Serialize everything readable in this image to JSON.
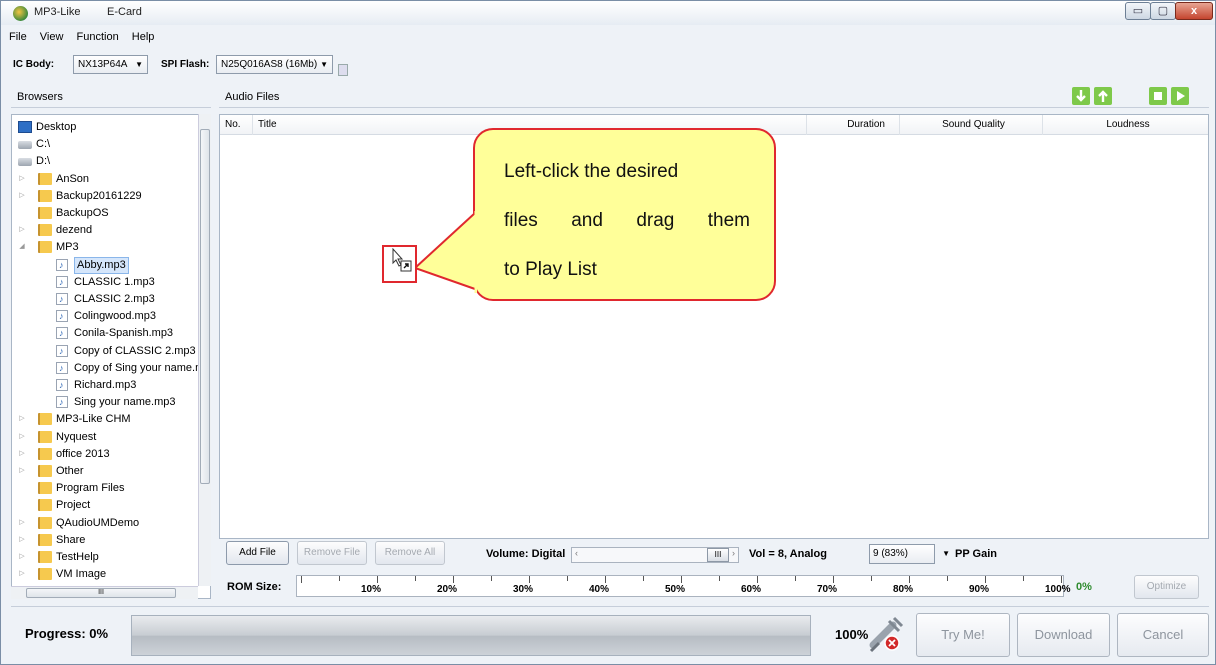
{
  "window": {
    "title": "MP3-Like",
    "subtitle": "E-Card",
    "controls": {
      "minimize": "▭",
      "maximize": "▢",
      "close": "x"
    }
  },
  "menu": {
    "items": [
      "File",
      "View",
      "Function",
      "Help"
    ]
  },
  "toolbar": {
    "ic_body_label": "IC Body:",
    "ic_body_value": "NX13P64A",
    "spi_flash_label": "SPI Flash:",
    "spi_flash_value": "N25Q016AS8 (16Mb)"
  },
  "browsers": {
    "header": "Browsers",
    "items": [
      {
        "label": "Desktop",
        "type": "desktop",
        "level": 0,
        "expander": ""
      },
      {
        "label": "C:\\",
        "type": "drive",
        "level": 0,
        "expander": ""
      },
      {
        "label": "D:\\",
        "type": "drive",
        "level": 0,
        "expander": ""
      },
      {
        "label": "AnSon",
        "type": "folder",
        "level": 1,
        "expander": "▷"
      },
      {
        "label": "Backup20161229",
        "type": "folder",
        "level": 1,
        "expander": "▷"
      },
      {
        "label": "BackupOS",
        "type": "folder",
        "level": 1,
        "expander": ""
      },
      {
        "label": "dezend",
        "type": "folder",
        "level": 1,
        "expander": "▷"
      },
      {
        "label": "MP3",
        "type": "folder",
        "level": 1,
        "expander": "◢"
      },
      {
        "label": "Abby.mp3",
        "type": "file",
        "level": 2,
        "expander": "",
        "selected": true
      },
      {
        "label": "CLASSIC 1.mp3",
        "type": "file",
        "level": 2,
        "expander": ""
      },
      {
        "label": "CLASSIC 2.mp3",
        "type": "file",
        "level": 2,
        "expander": ""
      },
      {
        "label": "Colingwood.mp3",
        "type": "file",
        "level": 2,
        "expander": ""
      },
      {
        "label": "Conila-Spanish.mp3",
        "type": "file",
        "level": 2,
        "expander": ""
      },
      {
        "label": "Copy of CLASSIC 2.mp3",
        "type": "file",
        "level": 2,
        "expander": ""
      },
      {
        "label": "Copy of Sing your name.mp",
        "type": "file",
        "level": 2,
        "expander": ""
      },
      {
        "label": "Richard.mp3",
        "type": "file",
        "level": 2,
        "expander": ""
      },
      {
        "label": "Sing your name.mp3",
        "type": "file",
        "level": 2,
        "expander": ""
      },
      {
        "label": "MP3-Like CHM",
        "type": "folder",
        "level": 1,
        "expander": "▷"
      },
      {
        "label": "Nyquest",
        "type": "folder",
        "level": 1,
        "expander": "▷"
      },
      {
        "label": "office 2013",
        "type": "folder",
        "level": 1,
        "expander": "▷"
      },
      {
        "label": "Other",
        "type": "folder",
        "level": 1,
        "expander": "▷"
      },
      {
        "label": "Program Files",
        "type": "folder",
        "level": 1,
        "expander": ""
      },
      {
        "label": "Project",
        "type": "folder",
        "level": 1,
        "expander": ""
      },
      {
        "label": "QAudioUMDemo",
        "type": "folder",
        "level": 1,
        "expander": "▷"
      },
      {
        "label": "Share",
        "type": "folder",
        "level": 1,
        "expander": "▷"
      },
      {
        "label": "TestHelp",
        "type": "folder",
        "level": 1,
        "expander": "▷"
      },
      {
        "label": "VM Image",
        "type": "folder",
        "level": 1,
        "expander": "▷"
      }
    ],
    "hscroll_glyph": "III"
  },
  "audio": {
    "header": "Audio Files",
    "columns": {
      "no": "No.",
      "title": "Title",
      "duration": "Duration",
      "quality": "Sound Quality",
      "loudness": "Loudness"
    },
    "icon_colors": {
      "green": "#7ec94a"
    }
  },
  "callout": {
    "lines": [
      "Left-click the desired",
      "files and drag them",
      "to Play List"
    ],
    "line2_words": [
      "files",
      "and",
      "drag",
      "them"
    ]
  },
  "controls": {
    "add_file": "Add File",
    "remove_file": "Remove File",
    "remove_all": "Remove All",
    "volume_label": "Volume: Digital",
    "vol_thumb_glyph": "III",
    "vol_text": "Vol = 8,  Analog",
    "analog_value": "9 (83%)",
    "pp_gain": "PP Gain",
    "rom_label": "ROM Size:",
    "rom_ticks": [
      "10%",
      "20%",
      "30%",
      "40%",
      "50%",
      "60%",
      "70%",
      "80%",
      "90%",
      "100%"
    ],
    "rom_used": "0%",
    "optimize": "Optimize"
  },
  "progress": {
    "label": "Progress:  0%",
    "value": 0,
    "end_label": "100%",
    "try_me": "Try Me!",
    "download": "Download",
    "cancel": "Cancel"
  }
}
